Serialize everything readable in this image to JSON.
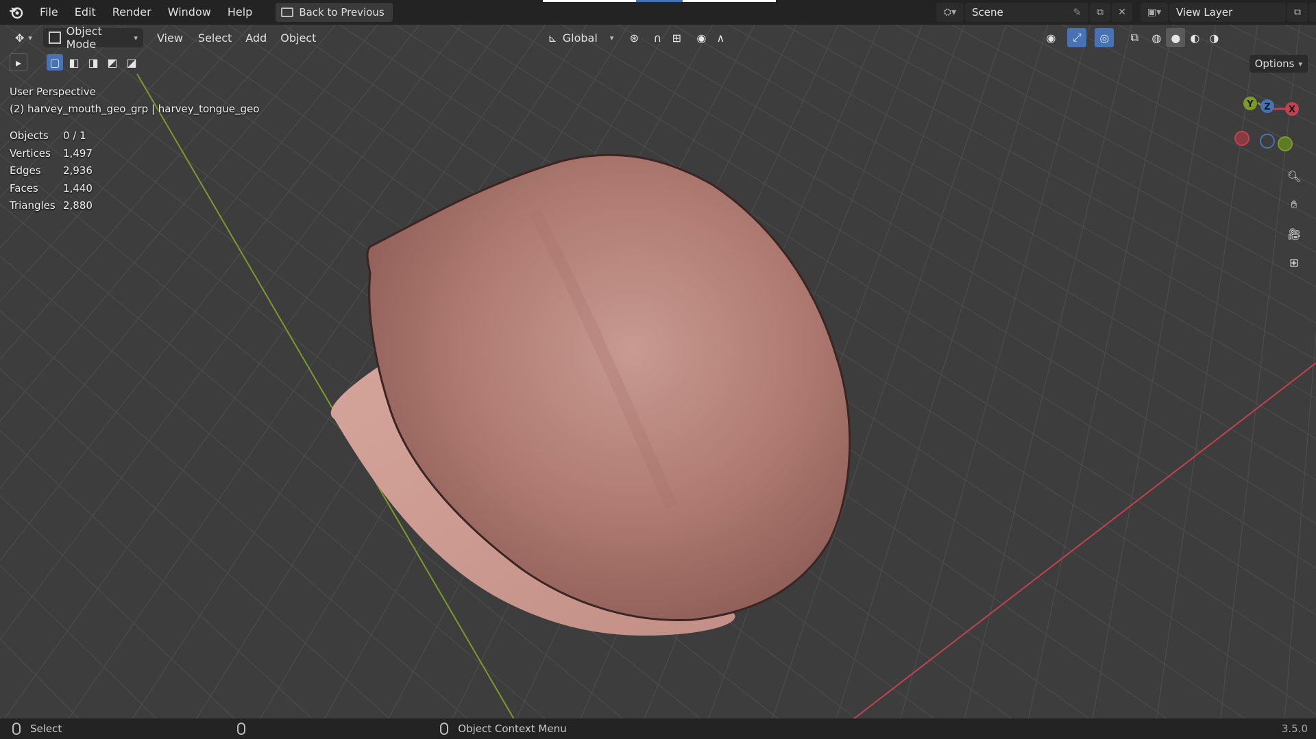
{
  "menu": {
    "items": [
      "File",
      "Edit",
      "Render",
      "Window",
      "Help"
    ],
    "back_label": "Back to Previous"
  },
  "scene": {
    "name": "Scene",
    "view_layer": "View Layer"
  },
  "header": {
    "mode": "Object Mode",
    "menus": [
      "View",
      "Select",
      "Add",
      "Object"
    ],
    "orientation": "Global"
  },
  "viewport": {
    "perspective": "User Perspective",
    "object_path": "(2) harvey_mouth_geo_grp | harvey_tongue_geo",
    "options_label": "Options",
    "stats": [
      {
        "label": "Objects",
        "value": "0 / 1"
      },
      {
        "label": "Vertices",
        "value": "1,497"
      },
      {
        "label": "Edges",
        "value": "2,936"
      },
      {
        "label": "Faces",
        "value": "1,440"
      },
      {
        "label": "Triangles",
        "value": "2,880"
      }
    ],
    "gizmo_labels": {
      "x": "X",
      "y": "Y",
      "z": "Z"
    }
  },
  "statusbar": {
    "select_label": "Select",
    "context_label": "Object Context Menu",
    "version": "3.5.0"
  },
  "colors": {
    "grid_bg": "#3d3d3d",
    "axis_x": "#c4424f",
    "axis_y": "#7a9b2a",
    "mesh": "#b97c74",
    "accent": "#4772b3"
  }
}
